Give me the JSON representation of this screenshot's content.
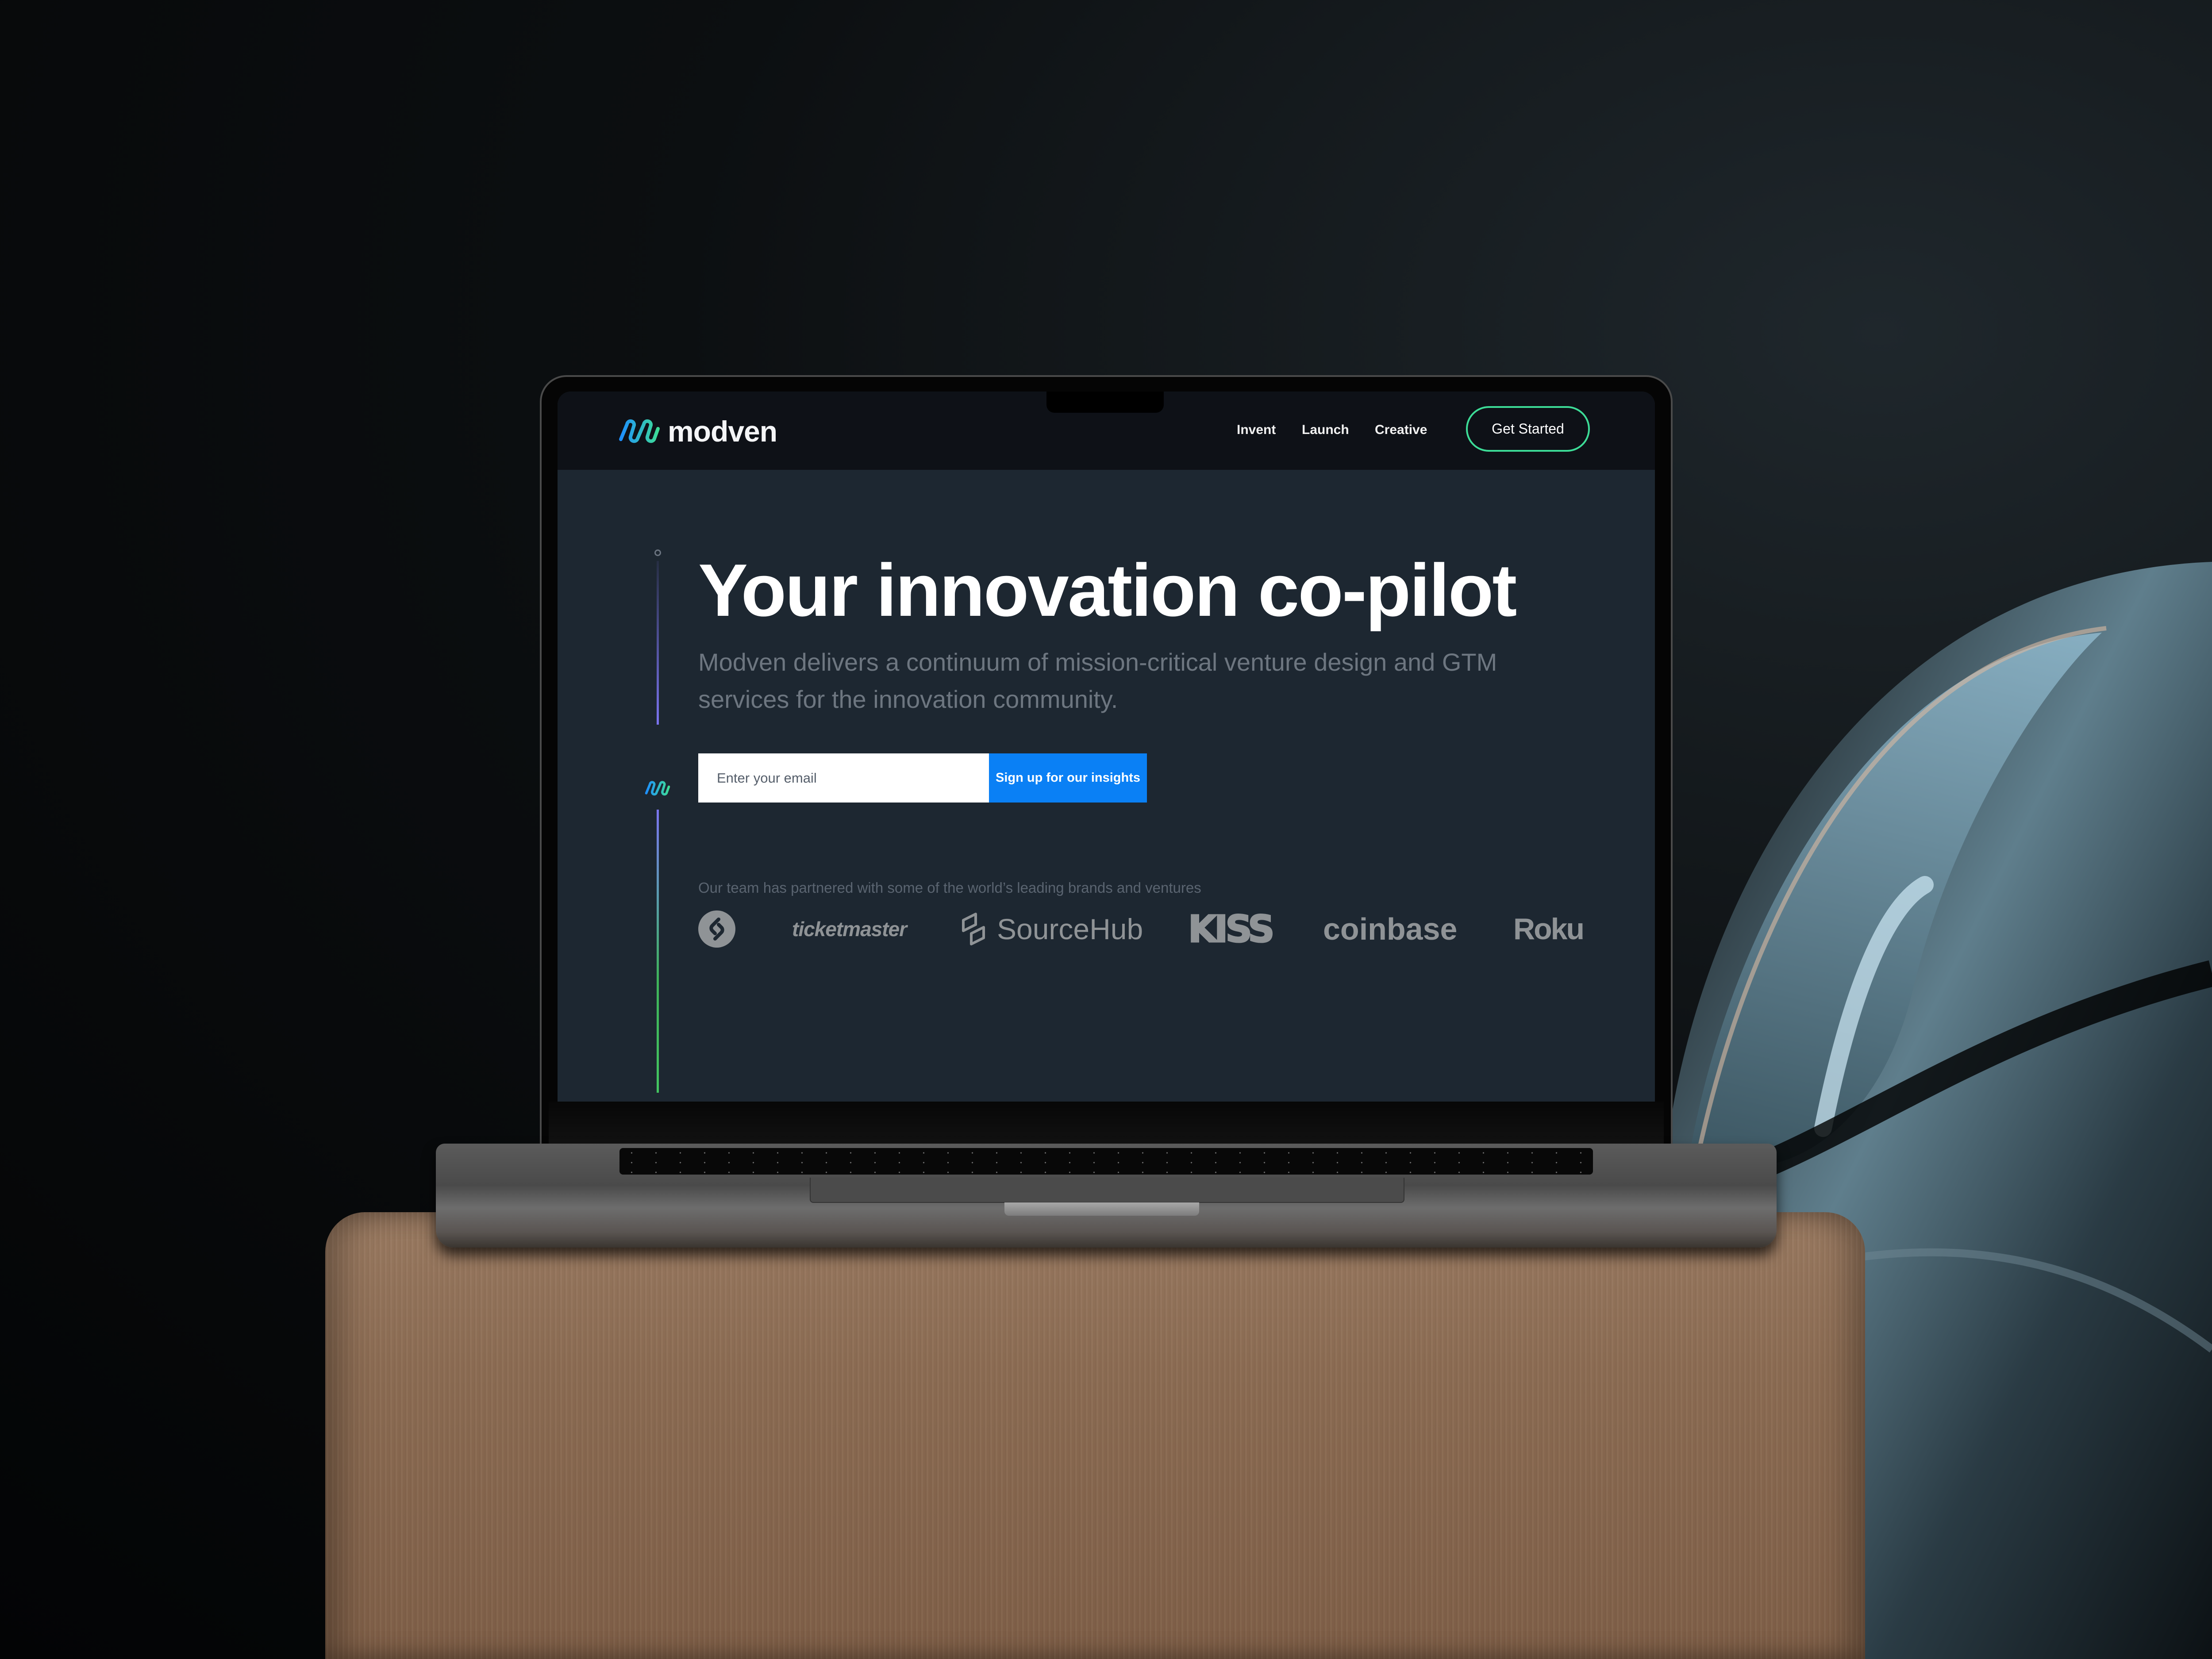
{
  "brand": {
    "name": "modven",
    "logo_icon": "modven-link-icon",
    "gradient": [
      "#1e90ff",
      "#3ddc97"
    ]
  },
  "nav": {
    "links": [
      {
        "label": "Invent"
      },
      {
        "label": "Launch"
      },
      {
        "label": "Creative"
      }
    ],
    "cta_label": "Get Started",
    "cta_border_color": "#3ddc97"
  },
  "hero": {
    "title": "Your innovation co-pilot",
    "subtitle": "Modven delivers a continuum of mission-critical venture design and GTM services for the innovation community."
  },
  "signup": {
    "email_placeholder": "Enter your email",
    "email_value": "",
    "button_label": "Sign up for our insights",
    "button_color": "#0a80f5"
  },
  "partners": {
    "label": "Our team has partnered with some of the world’s leading brands and ventures",
    "logos": [
      {
        "name": "Shazam",
        "icon": "shazam-logo-icon"
      },
      {
        "name": "ticketmaster"
      },
      {
        "name": "SourceHub",
        "icon": "sourcehub-logo-icon"
      },
      {
        "name": "KISS"
      },
      {
        "name": "coinbase"
      },
      {
        "name": "Roku"
      }
    ]
  },
  "colors": {
    "nav_bg": "#0e1117",
    "page_bg": "#1d2731",
    "timeline_top": "#7b74f0",
    "timeline_bottom": "#43c560"
  }
}
